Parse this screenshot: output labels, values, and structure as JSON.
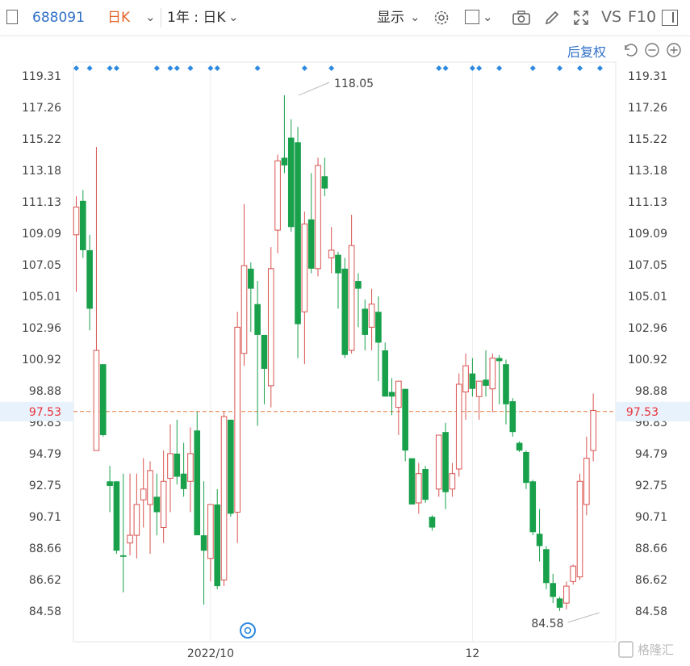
{
  "toolbar": {
    "stock_code": "688091",
    "period": "日K",
    "range": "1年 : 日K",
    "display": "显示",
    "vs_label": "VS",
    "f10_label": "F10",
    "adjust": "后复权"
  },
  "colors": {
    "up": "#d9534f",
    "down": "#19a04b",
    "current": "#e8333a",
    "accent": "#2f6fc7"
  },
  "chart_data": {
    "type": "candlestick",
    "y_ticks": [
      "119.31",
      "117.26",
      "115.22",
      "113.18",
      "111.13",
      "109.09",
      "107.05",
      "105.01",
      "102.96",
      "100.92",
      "98.88",
      "96.83",
      "94.79",
      "92.75",
      "90.71",
      "88.66",
      "86.62",
      "84.58"
    ],
    "ylim": [
      84.58,
      119.31
    ],
    "x_ticks": [
      {
        "index": 20,
        "label": "2022/10"
      },
      {
        "index": 59,
        "label": "12"
      }
    ],
    "current_price": "97.53",
    "high_annotation": {
      "index": 33,
      "value": 118.05,
      "label": "118.05"
    },
    "low_annotation": {
      "index": 78,
      "value": 84.58,
      "label": "84.58"
    },
    "event_marker_indices": [
      0,
      2,
      5,
      6,
      12,
      14,
      15,
      17,
      20,
      21,
      27,
      34,
      38,
      54,
      55,
      59,
      60,
      63,
      68,
      72,
      75,
      78
    ],
    "candles": [
      {
        "o": 109.0,
        "h": 111.5,
        "l": 105.3,
        "c": 110.8
      },
      {
        "o": 111.2,
        "h": 111.9,
        "l": 107.5,
        "c": 108.0
      },
      {
        "o": 108.0,
        "h": 109.0,
        "l": 102.8,
        "c": 104.2
      },
      {
        "o": 95.0,
        "h": 114.7,
        "l": 95.0,
        "c": 101.5
      },
      {
        "o": 100.6,
        "h": 100.6,
        "l": 95.9,
        "c": 96.0
      },
      {
        "o": 93.0,
        "h": 94.0,
        "l": 91.0,
        "c": 92.7
      },
      {
        "o": 93.0,
        "h": 93.0,
        "l": 88.3,
        "c": 88.5
      },
      {
        "o": 88.2,
        "h": 93.5,
        "l": 85.8,
        "c": 88.1
      },
      {
        "o": 89.0,
        "h": 93.5,
        "l": 88.2,
        "c": 89.5
      },
      {
        "o": 89.5,
        "h": 93.5,
        "l": 88.0,
        "c": 91.5
      },
      {
        "o": 91.8,
        "h": 94.5,
        "l": 90.0,
        "c": 92.5
      },
      {
        "o": 91.5,
        "h": 94.3,
        "l": 88.3,
        "c": 93.7
      },
      {
        "o": 92.0,
        "h": 93.5,
        "l": 89.5,
        "c": 91.0
      },
      {
        "o": 90.0,
        "h": 95.0,
        "l": 89.0,
        "c": 93.0
      },
      {
        "o": 93.2,
        "h": 96.7,
        "l": 91.0,
        "c": 94.8
      },
      {
        "o": 94.8,
        "h": 97.0,
        "l": 92.8,
        "c": 93.3
      },
      {
        "o": 93.5,
        "h": 95.5,
        "l": 92.0,
        "c": 92.5
      },
      {
        "o": 93.0,
        "h": 96.5,
        "l": 91.0,
        "c": 94.8
      },
      {
        "o": 96.3,
        "h": 97.5,
        "l": 89.8,
        "c": 89.5
      },
      {
        "o": 89.5,
        "h": 93.0,
        "l": 85.0,
        "c": 88.5
      },
      {
        "o": 88.0,
        "h": 91.5,
        "l": 86.5,
        "c": 91.5
      },
      {
        "o": 91.5,
        "h": 92.5,
        "l": 86.0,
        "c": 86.2
      },
      {
        "o": 86.6,
        "h": 97.5,
        "l": 86.2,
        "c": 97.2
      },
      {
        "o": 97.0,
        "h": 97.0,
        "l": 90.7,
        "c": 90.9
      },
      {
        "o": 91.0,
        "h": 104.0,
        "l": 89.0,
        "c": 103.0
      },
      {
        "o": 101.3,
        "h": 111.0,
        "l": 100.5,
        "c": 107.0
      },
      {
        "o": 106.8,
        "h": 107.2,
        "l": 102.7,
        "c": 105.5
      },
      {
        "o": 104.5,
        "h": 106.0,
        "l": 96.6,
        "c": 102.5
      },
      {
        "o": 102.5,
        "h": 102.5,
        "l": 98.0,
        "c": 100.3
      },
      {
        "o": 99.2,
        "h": 108.2,
        "l": 97.8,
        "c": 106.8
      },
      {
        "o": 109.3,
        "h": 114.2,
        "l": 107.8,
        "c": 113.8
      },
      {
        "o": 114.0,
        "h": 118.05,
        "l": 113.0,
        "c": 113.5
      },
      {
        "o": 115.3,
        "h": 116.5,
        "l": 109.2,
        "c": 109.5
      },
      {
        "o": 115.0,
        "h": 116.0,
        "l": 101.0,
        "c": 103.2
      },
      {
        "o": 104.0,
        "h": 110.5,
        "l": 100.6,
        "c": 109.7
      },
      {
        "o": 110.0,
        "h": 113.0,
        "l": 106.5,
        "c": 106.8
      },
      {
        "o": 106.8,
        "h": 114.0,
        "l": 106.3,
        "c": 113.5
      },
      {
        "o": 112.8,
        "h": 114.0,
        "l": 111.5,
        "c": 112.0
      },
      {
        "o": 107.5,
        "h": 109.5,
        "l": 106.5,
        "c": 108.0
      },
      {
        "o": 107.7,
        "h": 107.9,
        "l": 104.2,
        "c": 106.5
      },
      {
        "o": 106.8,
        "h": 107.5,
        "l": 101.0,
        "c": 101.2
      },
      {
        "o": 101.5,
        "h": 110.3,
        "l": 101.3,
        "c": 108.3
      },
      {
        "o": 106.0,
        "h": 106.5,
        "l": 103.0,
        "c": 105.5
      },
      {
        "o": 104.2,
        "h": 104.8,
        "l": 101.5,
        "c": 102.5
      },
      {
        "o": 103.0,
        "h": 105.5,
        "l": 101.5,
        "c": 104.5
      },
      {
        "o": 104.0,
        "h": 105.0,
        "l": 99.5,
        "c": 102.0
      },
      {
        "o": 101.5,
        "h": 102.0,
        "l": 98.5,
        "c": 98.5
      },
      {
        "o": 98.8,
        "h": 99.7,
        "l": 97.3,
        "c": 98.5
      },
      {
        "o": 97.8,
        "h": 99.5,
        "l": 96.0,
        "c": 99.5
      },
      {
        "o": 99.0,
        "h": 99.0,
        "l": 94.3,
        "c": 95.0
      },
      {
        "o": 94.5,
        "h": 94.5,
        "l": 91.5,
        "c": 91.5
      },
      {
        "o": 91.6,
        "h": 94.2,
        "l": 90.9,
        "c": 93.5
      },
      {
        "o": 93.8,
        "h": 94.0,
        "l": 91.6,
        "c": 91.8
      },
      {
        "o": 90.7,
        "h": 90.8,
        "l": 89.8,
        "c": 90.0
      },
      {
        "o": 92.5,
        "h": 96.0,
        "l": 92.0,
        "c": 96.0
      },
      {
        "o": 96.2,
        "h": 96.8,
        "l": 91.2,
        "c": 92.3
      },
      {
        "o": 92.5,
        "h": 94.2,
        "l": 92.0,
        "c": 93.5
      },
      {
        "o": 93.8,
        "h": 100.0,
        "l": 93.3,
        "c": 99.3
      },
      {
        "o": 98.8,
        "h": 101.3,
        "l": 97.0,
        "c": 100.5
      },
      {
        "o": 100.0,
        "h": 101.0,
        "l": 98.5,
        "c": 99.0
      },
      {
        "o": 98.5,
        "h": 99.5,
        "l": 97.0,
        "c": 99.5
      },
      {
        "o": 99.6,
        "h": 101.5,
        "l": 98.5,
        "c": 99.2
      },
      {
        "o": 99.0,
        "h": 101.3,
        "l": 97.5,
        "c": 101.0
      },
      {
        "o": 101.0,
        "h": 101.2,
        "l": 98.0,
        "c": 100.8
      },
      {
        "o": 100.6,
        "h": 100.9,
        "l": 96.7,
        "c": 98.0
      },
      {
        "o": 98.2,
        "h": 98.4,
        "l": 95.9,
        "c": 96.2
      },
      {
        "o": 95.5,
        "h": 95.6,
        "l": 94.9,
        "c": 95.0
      },
      {
        "o": 94.9,
        "h": 95.0,
        "l": 92.5,
        "c": 92.9
      },
      {
        "o": 93.0,
        "h": 93.1,
        "l": 89.5,
        "c": 89.7
      },
      {
        "o": 89.6,
        "h": 91.2,
        "l": 87.8,
        "c": 88.8
      },
      {
        "o": 88.6,
        "h": 88.8,
        "l": 86.0,
        "c": 86.4
      },
      {
        "o": 86.4,
        "h": 87.0,
        "l": 85.1,
        "c": 85.5
      },
      {
        "o": 85.4,
        "h": 85.5,
        "l": 84.58,
        "c": 84.8
      },
      {
        "o": 85.1,
        "h": 86.5,
        "l": 84.7,
        "c": 86.2
      },
      {
        "o": 86.5,
        "h": 87.6,
        "l": 86.3,
        "c": 87.5
      },
      {
        "o": 86.8,
        "h": 93.5,
        "l": 86.6,
        "c": 93.0
      },
      {
        "o": 91.5,
        "h": 95.9,
        "l": 90.8,
        "c": 94.5
      },
      {
        "o": 95.0,
        "h": 98.7,
        "l": 94.3,
        "c": 97.6
      }
    ]
  },
  "watermark": "格隆汇"
}
